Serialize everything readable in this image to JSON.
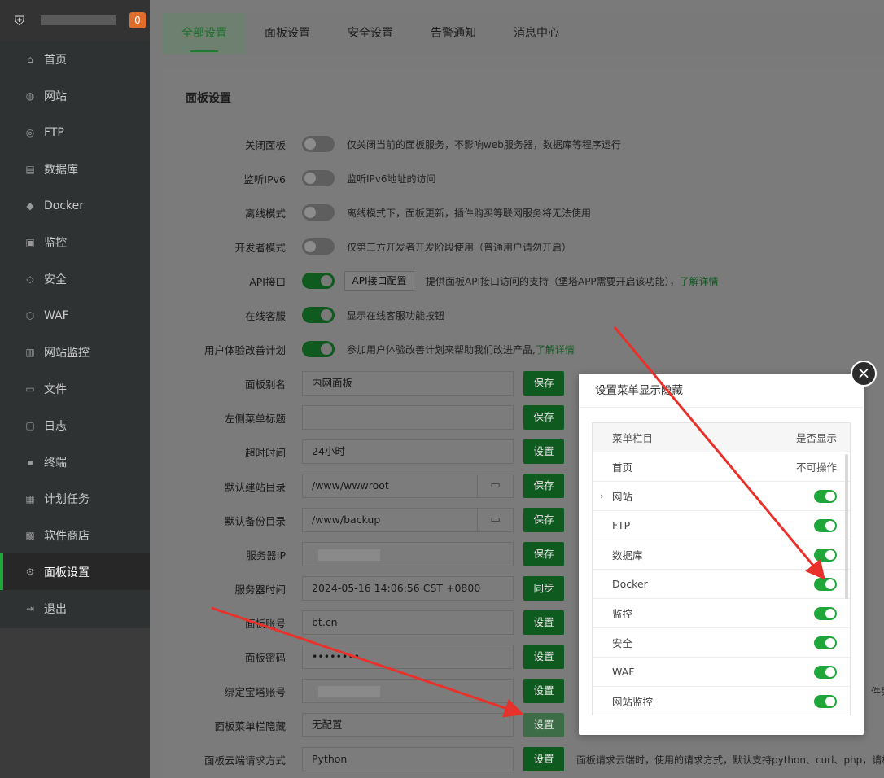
{
  "sidebar": {
    "badge": "0",
    "items": [
      {
        "label": "首页",
        "icon": "home-icon",
        "glyph": "⌂"
      },
      {
        "label": "网站",
        "icon": "globe-icon",
        "glyph": "◍"
      },
      {
        "label": "FTP",
        "icon": "ftp-icon",
        "glyph": "◎"
      },
      {
        "label": "数据库",
        "icon": "database-icon",
        "glyph": "▤"
      },
      {
        "label": "Docker",
        "icon": "docker-icon",
        "glyph": "◆"
      },
      {
        "label": "监控",
        "icon": "monitor-icon",
        "glyph": "▣"
      },
      {
        "label": "安全",
        "icon": "shield-icon",
        "glyph": "◇"
      },
      {
        "label": "WAF",
        "icon": "waf-icon",
        "glyph": "⬡"
      },
      {
        "label": "网站监控",
        "icon": "chart-icon",
        "glyph": "▥"
      },
      {
        "label": "文件",
        "icon": "folder-icon",
        "glyph": "▭"
      },
      {
        "label": "日志",
        "icon": "log-icon",
        "glyph": "▢"
      },
      {
        "label": "终端",
        "icon": "terminal-icon",
        "glyph": "▪"
      },
      {
        "label": "计划任务",
        "icon": "task-icon",
        "glyph": "▦"
      },
      {
        "label": "软件商店",
        "icon": "store-icon",
        "glyph": "▩"
      },
      {
        "label": "面板设置",
        "icon": "gear-icon",
        "glyph": "⚙"
      },
      {
        "label": "退出",
        "icon": "logout-icon",
        "glyph": "⇥"
      }
    ]
  },
  "tabs": [
    "全部设置",
    "面板设置",
    "安全设置",
    "告警通知",
    "消息中心"
  ],
  "panel": {
    "title": "面板设置",
    "toggles": [
      {
        "label": "关闭面板",
        "on": false,
        "desc": "仅关闭当前的面板服务，不影响web服务器，数据库等程序运行"
      },
      {
        "label": "监听IPv6",
        "on": false,
        "desc": "监听IPv6地址的访问"
      },
      {
        "label": "离线模式",
        "on": false,
        "desc": "离线模式下，面板更新，插件购买等联网服务将无法使用"
      },
      {
        "label": "开发者模式",
        "on": false,
        "desc": "仅第三方开发者开发阶段使用（普通用户请勿开启）"
      }
    ],
    "api": {
      "label": "API接口",
      "button": "API接口配置",
      "desc": "提供面板API接口访问的支持（堡塔APP需要开启该功能），",
      "link": "了解详情"
    },
    "service": {
      "label": "在线客服",
      "desc": "显示在线客服功能按钮"
    },
    "ux": {
      "label": "用户体验改善计划",
      "desc": "参加用户体验改善计划来帮助我们改进产品,",
      "link": "了解详情"
    },
    "fields": [
      {
        "label": "面板别名",
        "value": "内网面板",
        "btn": "保存"
      },
      {
        "label": "左侧菜单标题",
        "value": "",
        "btn": "保存"
      },
      {
        "label": "超时时间",
        "value": "24小时",
        "btn": "设置"
      },
      {
        "label": "默认建站目录",
        "value": "/www/wwwroot",
        "btn": "保存"
      },
      {
        "label": "默认备份目录",
        "value": "/www/backup",
        "btn": "保存"
      },
      {
        "label": "服务器IP",
        "value": "",
        "btn": "保存"
      },
      {
        "label": "服务器时间",
        "value": "2024-05-16 14:06:56 CST +0800",
        "btn": "同步"
      },
      {
        "label": "面板账号",
        "value": "bt.cn",
        "btn": "设置"
      },
      {
        "label": "面板密码",
        "value": "••••••••",
        "btn": "设置"
      },
      {
        "label": "绑定宝塔账号",
        "value": "",
        "btn": "设置"
      },
      {
        "label": "面板菜单栏隐藏",
        "value": "无配置",
        "btn": "设置"
      },
      {
        "label": "面板云端请求方式",
        "value": "Python",
        "btn": "设置"
      }
    ],
    "cloud_desc": "面板请求云端时，使用的请求方式，默认支持python、curl、php，请根",
    "file_list_fragment": "件列"
  },
  "modal": {
    "title": "设置菜单显示隐藏",
    "col1": "菜单栏目",
    "col2": "是否显示",
    "not_editable": "不可操作",
    "rows": [
      {
        "label": "首页",
        "on": null
      },
      {
        "label": "网站",
        "on": true,
        "expandable": true
      },
      {
        "label": "FTP",
        "on": true
      },
      {
        "label": "数据库",
        "on": true
      },
      {
        "label": "Docker",
        "on": true
      },
      {
        "label": "监控",
        "on": true
      },
      {
        "label": "安全",
        "on": true
      },
      {
        "label": "WAF",
        "on": true
      },
      {
        "label": "网站监控",
        "on": true
      }
    ]
  },
  "colors": {
    "accent": "#20a53a",
    "arrow": "#e8312a"
  }
}
